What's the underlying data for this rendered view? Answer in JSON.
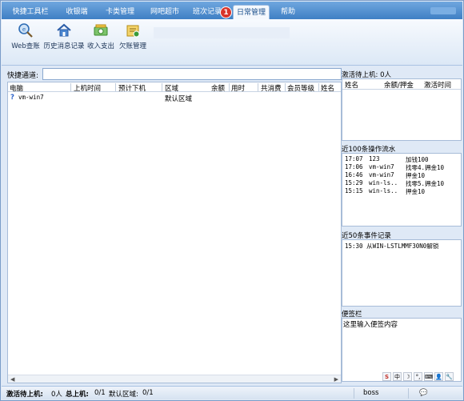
{
  "tabs": [
    {
      "label": "快捷工具栏"
    },
    {
      "label": "收银端"
    },
    {
      "label": "卡类管理"
    },
    {
      "label": "网吧超市"
    },
    {
      "label": "班次记录"
    },
    {
      "label": "日常管理"
    },
    {
      "label": "帮助"
    }
  ],
  "active_tab": "日常管理",
  "badge_count": "1",
  "ribbon": {
    "buttons": [
      {
        "label": "Web查账",
        "icon": "web-search-icon"
      },
      {
        "label": "历史消息记录",
        "icon": "home-icon"
      },
      {
        "label": "收入支出",
        "icon": "money-icon"
      },
      {
        "label": "欠账管理",
        "icon": "debt-icon"
      }
    ]
  },
  "quick_channel": {
    "label": "快捷通道:",
    "value": ""
  },
  "main_table": {
    "columns": [
      "电脑",
      "上机时间",
      "预计下机",
      "区域",
      "余额",
      "用时",
      "共消费",
      "会员等级",
      "姓名"
    ],
    "rows": [
      {
        "computer": "vm-win7",
        "start": "",
        "end": "",
        "zone": "默认区域",
        "balance": "",
        "used": "",
        "consume": "",
        "level": "",
        "name": ""
      }
    ]
  },
  "active_panel": {
    "title": "激活待上机: 0人",
    "columns": [
      "姓名",
      "余额/押金",
      "激活时间"
    ]
  },
  "ops_panel": {
    "title": "近100条操作流水",
    "rows": [
      {
        "time": "17:07",
        "who": "123",
        "action": "加钱100",
        "extra": ""
      },
      {
        "time": "17:06",
        "who": "vm-win7",
        "action": "找零4...",
        "extra": "押金10"
      },
      {
        "time": "16:46",
        "who": "vm-win7",
        "action": "押金10",
        "extra": ""
      },
      {
        "time": "15:29",
        "who": "win-ls..",
        "action": "找零5...",
        "extra": "押金10"
      },
      {
        "time": "15:15",
        "who": "win-ls..",
        "action": "押金10",
        "extra": ""
      }
    ]
  },
  "events_panel": {
    "title": "近50条事件记录",
    "rows": [
      {
        "text": "15:30 从WIN-LSTLMMF30N0解锁"
      }
    ]
  },
  "notes_panel": {
    "title": "便签栏",
    "placeholder": "这里输入便签内容"
  },
  "ime_bar": [
    "中",
    "☽",
    "°,",
    "⌨",
    "👤",
    "🔧"
  ],
  "status_bar": {
    "active_label": "激活待上机:",
    "active_value": "0人",
    "total_label": "总上机:",
    "total_value": "0/1",
    "zone_label": "默认区域:",
    "zone_value": "0/1",
    "user": "boss"
  }
}
